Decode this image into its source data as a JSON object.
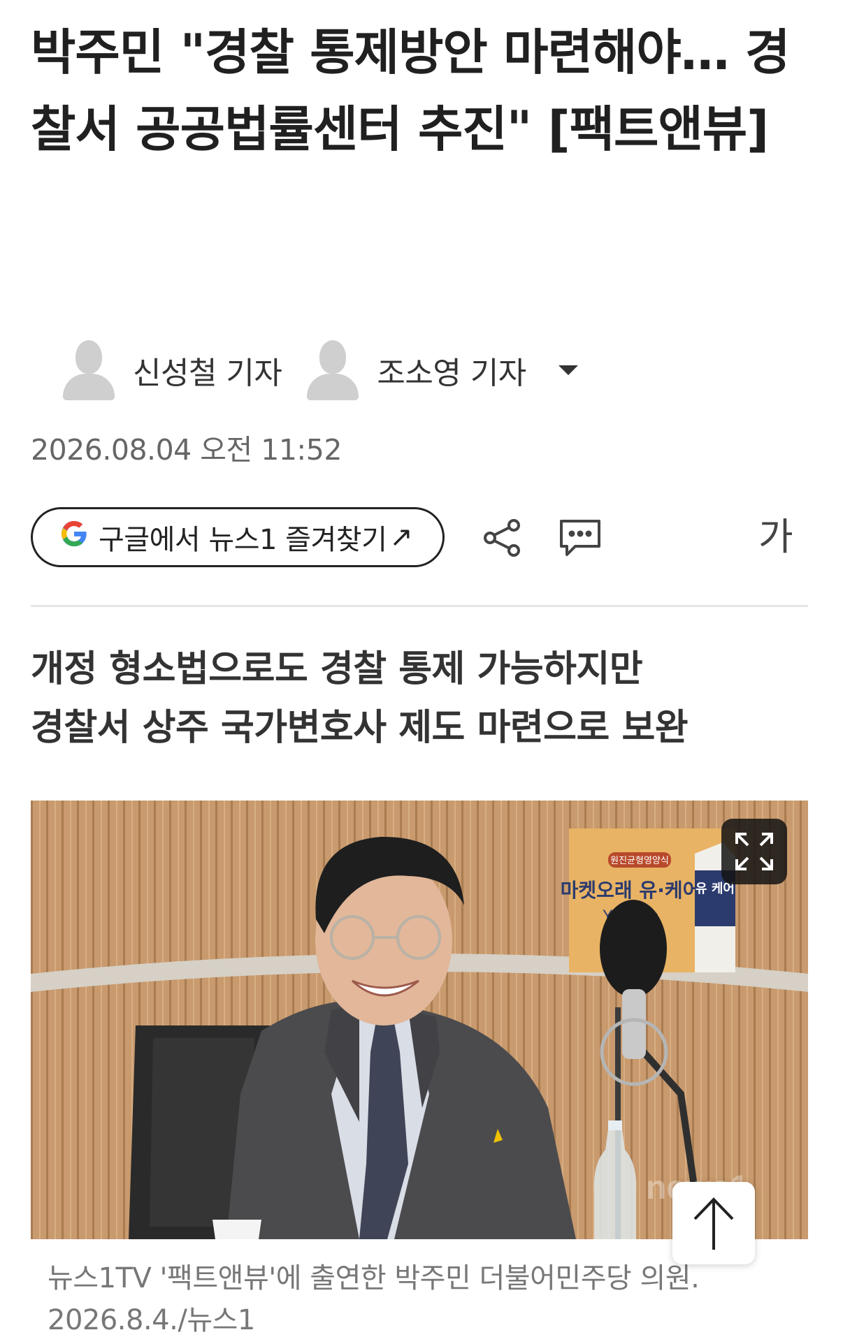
{
  "article": {
    "headline": "박주민 \"경찰 통제방안 마련해야… 경찰서 공공법률센터 추진\" [팩트앤뷰]",
    "authors": [
      {
        "name": "신성철 기자"
      },
      {
        "name": "조소영 기자"
      }
    ],
    "date": "2026.08.04 오전 11:52",
    "subheadline": [
      "개정 형소법으로도 경찰 통제 가능하지만",
      "경찰서 상주 국가변호사 제도 마련으로 보완"
    ],
    "photo": {
      "sign_badge": "원진균형영양식",
      "sign_title": "마켓오래 유·케어",
      "sign_brand": "Youcare",
      "carton_label": "유 케어",
      "watermark": "news1"
    },
    "caption": "뉴스1TV '팩트앤뷰'에 출연한 박주민 더불어민주당 의원. 2026.8.4./뉴스1"
  },
  "toolbar": {
    "google_button_label": "구글에서 뉴스1 즐겨찾기",
    "google_arrow": "↗",
    "google_g": "G",
    "font_size_label": "가"
  },
  "icons": {
    "share": "share-icon",
    "comment": "comment-icon",
    "expand": "expand-icon",
    "scroll_top": "arrow-up-icon"
  },
  "colors": {
    "google_blue": "#4285F4",
    "headline": "#202020"
  }
}
